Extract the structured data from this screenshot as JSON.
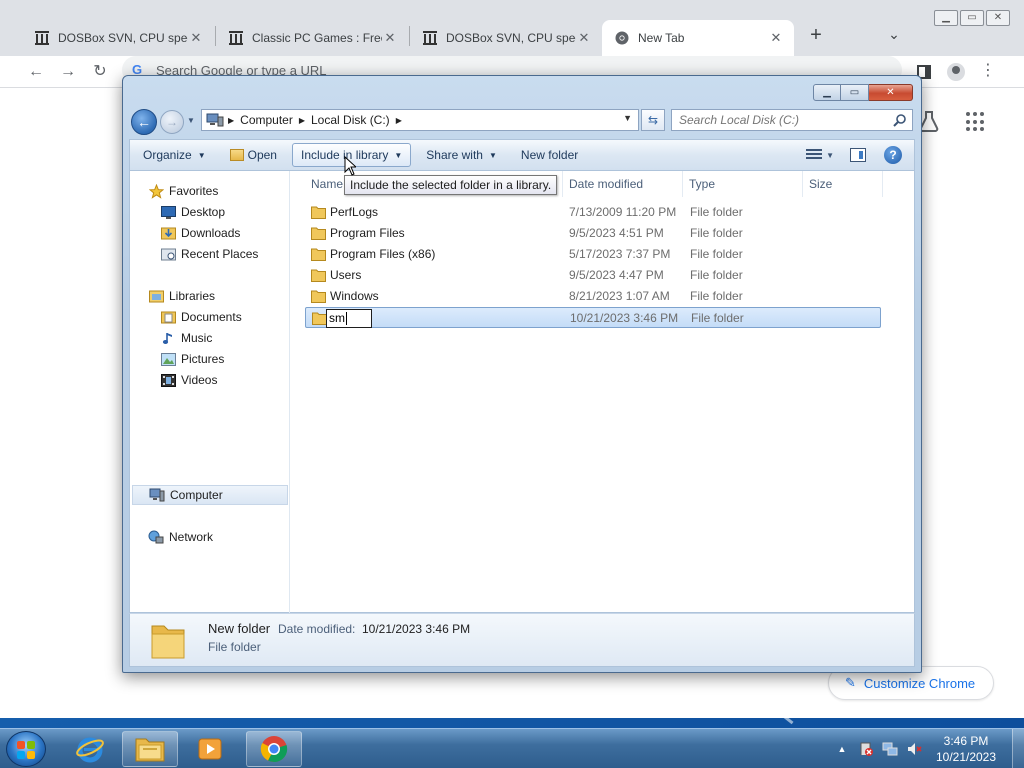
{
  "chrome": {
    "tabs": [
      {
        "title": "DOSBox SVN, CPU speed:",
        "close": "✕",
        "active": false
      },
      {
        "title": "Classic PC Games : Free",
        "close": "✕",
        "active": false
      },
      {
        "title": "DOSBox SVN, CPU speed:",
        "close": "✕",
        "active": false
      },
      {
        "title": "New Tab",
        "close": "✕",
        "active": true
      }
    ],
    "new_tab_symbol": "+",
    "tab_search_symbol": "⌄",
    "omnibox_placeholder": "Search Google or type a URL",
    "omnibox_g": "G",
    "customize_label": "Customize Chrome",
    "icons": [
      "back-icon",
      "forward-icon",
      "reload-icon",
      "side-panel-icon",
      "profile-icon",
      "menu-icon",
      "labs-icon",
      "apps-grid-icon"
    ]
  },
  "explorer": {
    "breadcrumb": [
      "Computer",
      "Local Disk (C:)"
    ],
    "search_placeholder": "Search Local Disk (C:)",
    "toolbar": {
      "organize": "Organize",
      "open": "Open",
      "include_in_library": "Include in library",
      "share_with": "Share with",
      "new_folder": "New folder"
    },
    "tooltip": "Include the selected folder in a library.",
    "nav": {
      "favorites_header": "Favorites",
      "favorites": [
        "Desktop",
        "Downloads",
        "Recent Places"
      ],
      "libraries_header": "Libraries",
      "libraries": [
        "Documents",
        "Music",
        "Pictures",
        "Videos"
      ],
      "computer": "Computer",
      "network": "Network"
    },
    "columns": {
      "name": "Name",
      "date": "Date modified",
      "type": "Type",
      "size": "Size"
    },
    "files": [
      {
        "name": "PerfLogs",
        "date": "7/13/2009 11:20 PM",
        "type": "File folder"
      },
      {
        "name": "Program Files",
        "date": "9/5/2023 4:51 PM",
        "type": "File folder"
      },
      {
        "name": "Program Files (x86)",
        "date": "5/17/2023 7:37 PM",
        "type": "File folder"
      },
      {
        "name": "Users",
        "date": "9/5/2023 4:47 PM",
        "type": "File folder"
      },
      {
        "name": "Windows",
        "date": "8/21/2023 1:07 AM",
        "type": "File folder"
      }
    ],
    "renaming_item": {
      "value": "sm",
      "date": "10/21/2023 3:46 PM",
      "type": "File folder"
    },
    "details": {
      "name": "New folder",
      "date_label": "Date modified:",
      "date_value": "10/21/2023 3:46 PM",
      "type": "File folder"
    },
    "colors": {
      "accent": "#3c7ac3",
      "selection": "#c4dcf7"
    }
  },
  "taskbar": {
    "time": "3:46 PM",
    "date": "10/21/2023",
    "pinned": [
      "internet-explorer-icon",
      "windows-explorer-icon",
      "media-player-icon",
      "chrome-icon"
    ],
    "tray_icons": [
      "show-hidden-icons",
      "action-center-icon",
      "network-icon",
      "volume-icon"
    ]
  }
}
